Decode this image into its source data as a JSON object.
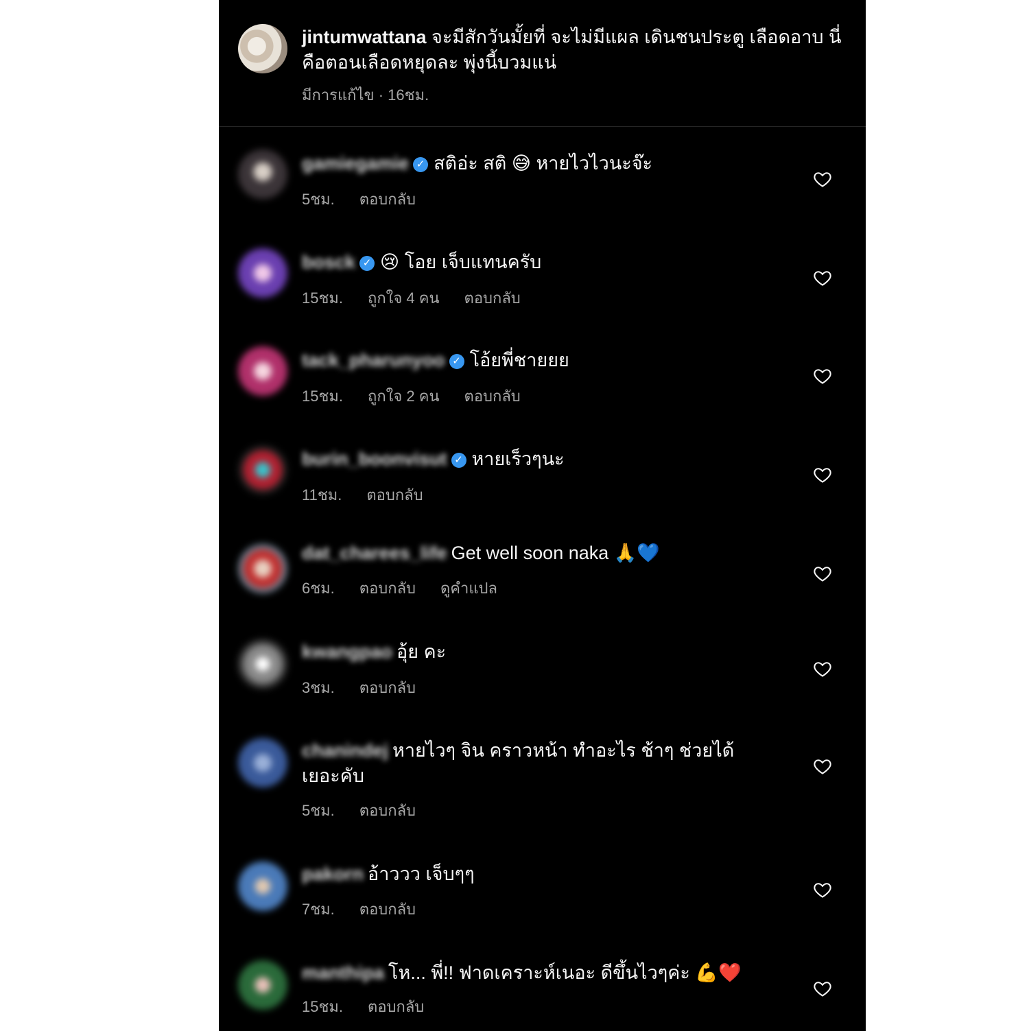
{
  "post": {
    "username": "jintumwattana",
    "caption": "จะมีสักวันมั้ยที่ จะไม่มีแผล เดินชนประตู เลือดอาบ นี่คือตอนเลือดหยุดละ พุ่งนี้บวมแน่",
    "edited": "มีการแก้ไข",
    "time": "16ชม."
  },
  "labels": {
    "reply": "ตอบกลับ",
    "translate": "ดูคำแปล"
  },
  "colors": {
    "background": "#000000",
    "text": "#f5f5f5",
    "muted": "#a8a8a8",
    "verified": "#3897f0",
    "divider": "#262626"
  },
  "icons": {
    "like": "heart-outline-icon",
    "verified": "verified-badge-icon"
  },
  "comments": [
    {
      "user": "gamiegamie",
      "verified": true,
      "text": "สติอ่ะ สติ 😅 หายไวไวนะจ๊ะ",
      "time": "5ชม.",
      "likes": "",
      "reply": "ตอบกลับ"
    },
    {
      "user": "bosck",
      "verified": true,
      "text": "😢 โอย เจ็บแทนครับ",
      "time": "15ชม.",
      "likes": "ถูกใจ 4 คน",
      "reply": "ตอบกลับ"
    },
    {
      "user": "tack_pharunyoo",
      "verified": true,
      "text": "โอ้ยพี่ชายยย",
      "time": "15ชม.",
      "likes": "ถูกใจ 2 คน",
      "reply": "ตอบกลับ"
    },
    {
      "user": "burin_boonvisut",
      "verified": true,
      "text": "หายเร็วๆนะ",
      "time": "11ชม.",
      "likes": "",
      "reply": "ตอบกลับ"
    },
    {
      "user": "dat_charees_life",
      "verified": false,
      "text": "Get well soon naka 🙏💙",
      "time": "6ชม.",
      "likes": "",
      "reply": "ตอบกลับ",
      "translate": "ดูคำแปล"
    },
    {
      "user": "kwangpao",
      "verified": false,
      "text": "อุ้ย คะ",
      "time": "3ชม.",
      "likes": "",
      "reply": "ตอบกลับ"
    },
    {
      "user": "chanindej",
      "verified": false,
      "text": "หายไวๆ จิน คราวหน้า ทำอะไร ช้าๆ ช่วยได้เยอะคับ",
      "time": "5ชม.",
      "likes": "",
      "reply": "ตอบกลับ"
    },
    {
      "user": "pakorn",
      "verified": false,
      "text": "อ้าววว เจ็บๆๆ",
      "time": "7ชม.",
      "likes": "",
      "reply": "ตอบกลับ"
    },
    {
      "user": "manthipa",
      "verified": false,
      "text": "โห... พี่!! ฟาดเคราะห์เนอะ ดีขึ้นไวๆค่ะ 💪❤️",
      "time": "15ชม.",
      "likes": "",
      "reply": "ตอบกลับ"
    }
  ]
}
